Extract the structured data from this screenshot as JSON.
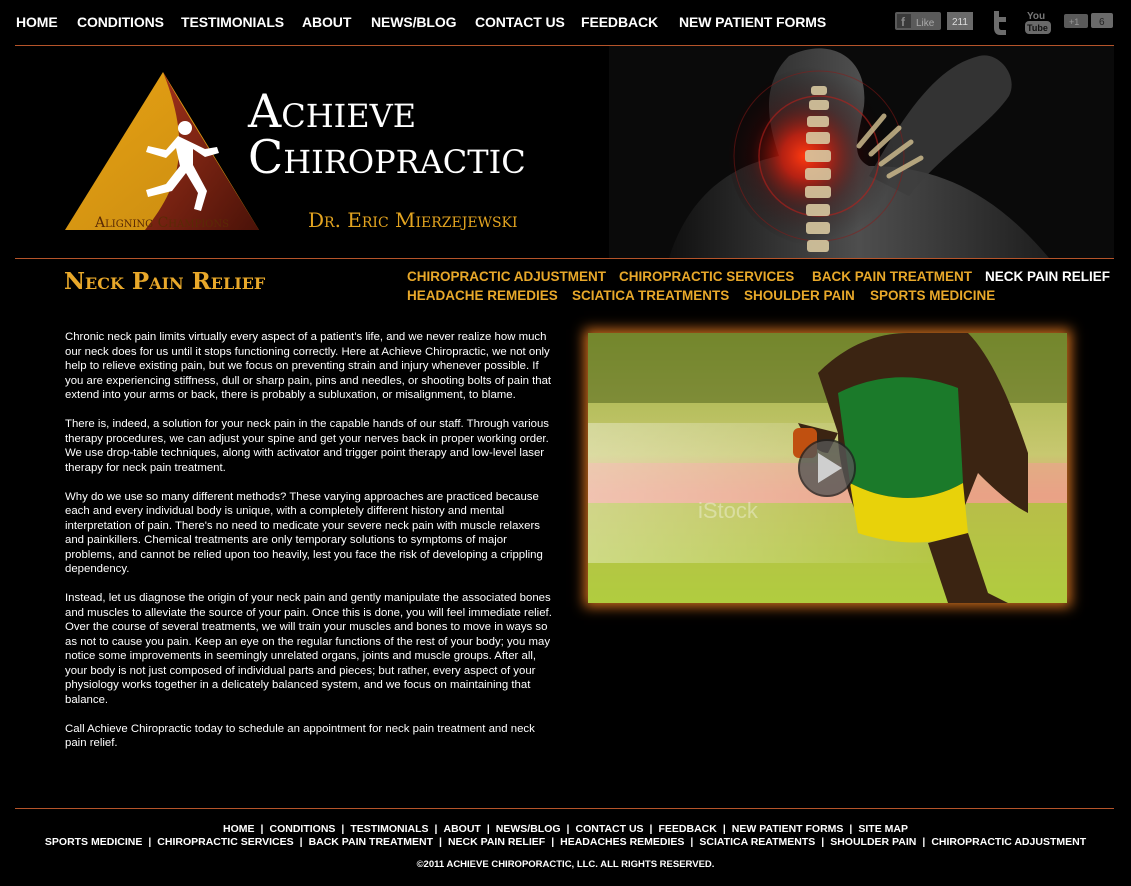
{
  "top_nav": [
    "HOME",
    "CONDITIONS",
    "TESTIMONIALS",
    "ABOUT",
    "NEWS/BLOG",
    "CONTACT US",
    "FEEDBACK",
    "NEW PATIENT FORMS"
  ],
  "social": {
    "like_label": "Like",
    "like_count": "211",
    "plus_label": "+1",
    "plus_count": "6",
    "youtube_label_1": "You",
    "youtube_label_2": "Tube"
  },
  "brand": {
    "line1": "Achieve",
    "line2": "Chiropractic",
    "doctor": "Dr. Eric Mierzejewski",
    "tagline": "Aligning Champions"
  },
  "page_title": "Neck Pain Relief",
  "sub_nav": {
    "row1": [
      "CHIROPRACTIC ADJUSTMENT",
      "CHIROPRACTIC SERVICES",
      "BACK PAIN TREATMENT",
      "NECK PAIN RELIEF"
    ],
    "row2": [
      "HEADACHE REMEDIES",
      "SCIATICA TREATMENTS",
      "SHOULDER PAIN",
      "SPORTS MEDICINE"
    ],
    "active": "NECK PAIN RELIEF"
  },
  "content": {
    "p1": "Chronic neck pain limits virtually every aspect of a patient's life, and we never realize how much our neck does for us until it stops functioning correctly. Here at Achieve Chiropractic, we not only help to relieve existing pain, but we focus on preventing strain and injury whenever possible. If you are experiencing stiffness, dull or sharp pain, pins and needles, or shooting bolts of pain that extend into your arms or back, there is probably a subluxation, or misalignment, to blame.",
    "p2": "There is, indeed, a solution for your neck pain in the capable hands of our staff. Through various therapy procedures, we can adjust your spine and get your nerves back in proper working order. We use drop-table techniques, along with activator and trigger point therapy and low-level laser therapy for neck pain treatment.",
    "p3": "Why do we use so many different methods? These varying approaches are practiced because each and every individual body is unique, with a completely different history and mental interpretation of pain. There's no need to medicate your severe neck pain with muscle relaxers and painkillers. Chemical treatments are only temporary solutions to symptoms of major problems, and cannot be relied upon too heavily, lest you face the risk of developing a crippling dependency.",
    "p4": "Instead, let us diagnose the origin of your neck pain and gently manipulate the associated bones and muscles to alleviate the source of your pain. Once this is done, you will feel immediate relief. Over the course of several treatments, we will train your muscles and bones to move in ways so as not to cause you pain. Keep an eye on the regular functions of the rest of your body; you may notice some improvements in seemingly unrelated organs, joints and muscle groups. After all, your body is not just composed of individual parts and pieces; but rather, every aspect of your physiology works together in a delicately balanced system, and we focus on maintaining that balance.",
    "p5": "Call Achieve Chiropractic today to schedule an appointment for neck pain treatment and neck pain relief."
  },
  "video_watermark": "iStock",
  "footer": {
    "row1": [
      "HOME",
      "CONDITIONS",
      "TESTIMONIALS",
      "ABOUT",
      "NEWS/BLOG",
      "CONTACT US",
      "FEEDBACK",
      "NEW PATIENT FORMS",
      "SITE MAP"
    ],
    "row2": [
      "SPORTS MEDICINE",
      "CHIROPRACTIC SERVICES",
      "BACK PAIN TREATMENT",
      "NECK PAIN RELIEF",
      "HEADACHES REMEDIES",
      "SCIATICA REATMENTS",
      "SHOULDER PAIN",
      "CHIROPRACTIC ADJUSTMENT"
    ],
    "separator": "|",
    "copyright": "©2011 ACHIEVE CHIROPORACTIC, LLC. ALL RIGHTS RESERVED."
  },
  "colors": {
    "accent": "#e8a82a",
    "rule": "#b5542a",
    "background": "#000000"
  }
}
